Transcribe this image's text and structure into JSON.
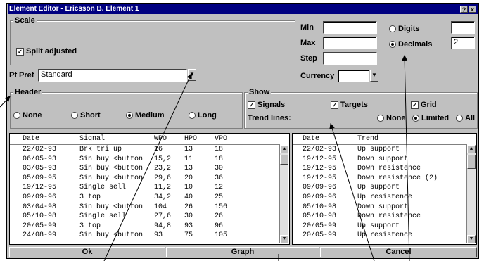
{
  "window": {
    "title": "Element Editor - Ericsson B. Element 1",
    "help_btn": "?",
    "close_btn": "×"
  },
  "scale": {
    "label": "Scale",
    "split_adjusted": "Split adjusted",
    "split_checked": true
  },
  "minmax": {
    "min_label": "Min",
    "max_label": "Max",
    "step_label": "Step",
    "min_value": "",
    "max_value": "",
    "step_value": ""
  },
  "precision": {
    "digits_label": "Digits",
    "decimals_label": "Decimals",
    "selected": "Decimals",
    "digits_value": "",
    "decimals_value": "2"
  },
  "pfpref": {
    "label": "Pf Pref",
    "value": "Standard"
  },
  "currency": {
    "label": "Currency",
    "value": ""
  },
  "header": {
    "label": "Header",
    "options": [
      "None",
      "Short",
      "Medium",
      "Long"
    ],
    "selected": "Medium"
  },
  "show": {
    "label": "Show",
    "signals": "Signals",
    "targets": "Targets",
    "grid": "Grid",
    "trend_lines_label": "Trend lines:",
    "trend_options": [
      "None",
      "Limited",
      "All"
    ],
    "trend_selected": "Limited"
  },
  "signals_table": {
    "columns": [
      "Date",
      "Signal",
      "WPO",
      "HPO",
      "VPO"
    ],
    "rows": [
      [
        "22/02-93",
        "Brk tri up",
        "16",
        "13",
        "18"
      ],
      [
        "06/05-93",
        "Sin buy <button",
        "15,2",
        "11",
        "18"
      ],
      [
        "03/05-93",
        "Sin buy <button",
        "23,2",
        "13",
        "30"
      ],
      [
        "05/09-95",
        "Sin buy <button",
        "29,6",
        "20",
        "36"
      ],
      [
        "19/12-95",
        "Single sell",
        "11,2",
        "10",
        "12"
      ],
      [
        "09/09-96",
        "3 top",
        "34,2",
        "40",
        "25"
      ],
      [
        "03/04-98",
        "Sin buy <button",
        "104",
        "26",
        "156"
      ],
      [
        "05/10-98",
        "Single sell",
        "27,6",
        "30",
        "26"
      ],
      [
        "20/05-99",
        "3 top",
        "94,8",
        "93",
        "96"
      ],
      [
        "24/08-99",
        "Sin buy <button",
        "93",
        "75",
        "105"
      ]
    ]
  },
  "trend_table": {
    "columns": [
      "Date",
      "Trend"
    ],
    "rows": [
      [
        "22/02-93",
        "Up support"
      ],
      [
        "19/12-95",
        "Down support"
      ],
      [
        "19/12-95",
        "Down resistence"
      ],
      [
        "19/12-95",
        "Down resistence (2)"
      ],
      [
        "09/09-96",
        "Up support"
      ],
      [
        "09/09-96",
        "Up resistence"
      ],
      [
        "05/10-98",
        "Down support"
      ],
      [
        "05/10-98",
        "Down resistence"
      ],
      [
        "20/05-99",
        "Up support"
      ],
      [
        "20/05-99",
        "Up resistence"
      ]
    ]
  },
  "buttons": {
    "ok": "Ok",
    "graph": "Graph",
    "cancel": "Cancel"
  }
}
